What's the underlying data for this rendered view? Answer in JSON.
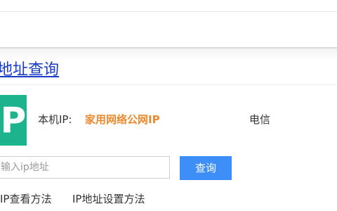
{
  "section": {
    "title": "地址查询"
  },
  "logo": {
    "letter": "P",
    "color": "#1db38c"
  },
  "ip_info": {
    "label": "本机IP:",
    "value": "家用网络公网IP",
    "value_color": "#ec8a2f",
    "isp": "电信"
  },
  "search": {
    "placeholder": "输入ip地址",
    "value": "",
    "button_label": "查询",
    "button_color": "#3e8ef7"
  },
  "links": [
    {
      "label": "IP查看方法"
    },
    {
      "label": "IP地址设置方法"
    }
  ]
}
